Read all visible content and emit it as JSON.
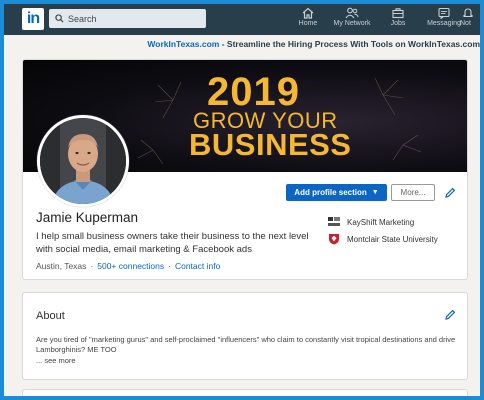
{
  "nav": {
    "logo": "in",
    "search_placeholder": "Search",
    "items": [
      {
        "label": "Home"
      },
      {
        "label": "My Network"
      },
      {
        "label": "Jobs"
      },
      {
        "label": "Messaging"
      },
      {
        "label": "Not"
      }
    ]
  },
  "promo": {
    "link": "WorkInTexas.com",
    "text": " - Streamline the Hiring Process With Tools on WorkInTexas.com"
  },
  "banner": {
    "year": "2019",
    "line1": "GROW YOUR",
    "line2": "BUSINESS"
  },
  "profile": {
    "name": "Jamie Kuperman",
    "headline": "I help small business owners take their business to the next level with social media, email marketing & Facebook ads",
    "location": "Austin, Texas",
    "connections": "500+ connections",
    "contact": "Contact info",
    "add_section_label": "Add profile section",
    "more_label": "More...",
    "company": "KayShift Marketing",
    "school": "Montclair State University"
  },
  "about": {
    "title": "About",
    "text": "Are you tired of \"marketing gurus\" and self-proclaimed \"influencers\" who claim to constantly visit tropical destinations and drive Lamborghinis? ME TOO",
    "see_more": "... see more"
  },
  "colors": {
    "nav_bg": "#283e4a",
    "accent": "#0a66c2",
    "banner_gold": "#f5b830",
    "frame_blue": "#1a8cd8"
  }
}
